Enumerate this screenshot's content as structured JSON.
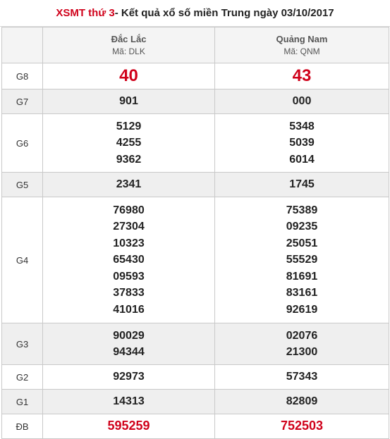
{
  "title": {
    "link": "XSMT thứ 3",
    "rest": " - Kết quả xổ số miền Trung ngày 03/10/2017"
  },
  "provinces": [
    {
      "name": "Đắc Lắc",
      "code": "Mã: DLK"
    },
    {
      "name": "Quảng Nam",
      "code": "Mã: QNM"
    }
  ],
  "rows": [
    {
      "label": "G8",
      "a": [
        "40"
      ],
      "b": [
        "43"
      ]
    },
    {
      "label": "G7",
      "a": [
        "901"
      ],
      "b": [
        "000"
      ]
    },
    {
      "label": "G6",
      "a": [
        "5129",
        "4255",
        "9362"
      ],
      "b": [
        "5348",
        "5039",
        "6014"
      ]
    },
    {
      "label": "G5",
      "a": [
        "2341"
      ],
      "b": [
        "1745"
      ]
    },
    {
      "label": "G4",
      "a": [
        "76980",
        "27304",
        "10323",
        "65430",
        "09593",
        "37833",
        "41016"
      ],
      "b": [
        "75389",
        "09235",
        "25051",
        "55529",
        "81691",
        "83161",
        "92619"
      ]
    },
    {
      "label": "G3",
      "a": [
        "90029",
        "94344"
      ],
      "b": [
        "02076",
        "21300"
      ]
    },
    {
      "label": "G2",
      "a": [
        "92973"
      ],
      "b": [
        "57343"
      ]
    },
    {
      "label": "G1",
      "a": [
        "14313"
      ],
      "b": [
        "82809"
      ]
    },
    {
      "label": "ĐB",
      "a": [
        "595259"
      ],
      "b": [
        "752503"
      ]
    }
  ],
  "colors": {
    "highlight": "#d0021b",
    "row_alt": "#efefef",
    "header_bg": "#f4f4f4"
  }
}
